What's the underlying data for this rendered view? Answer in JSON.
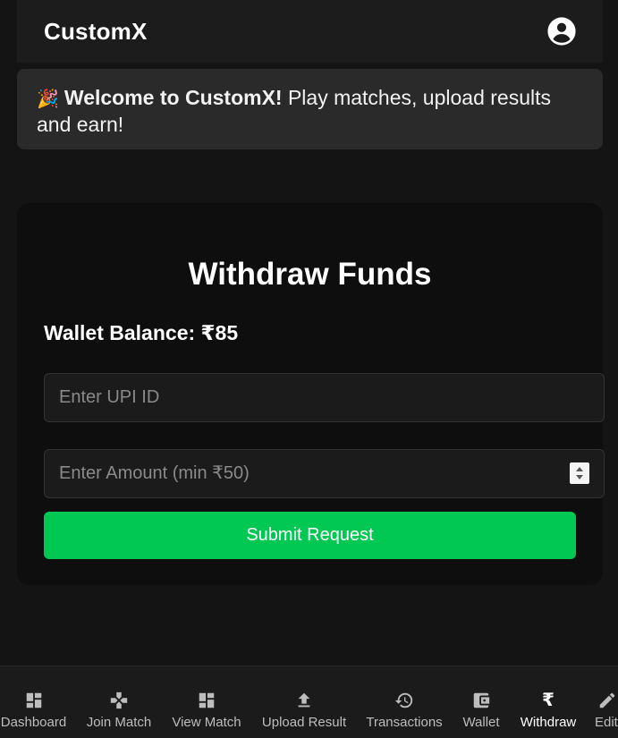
{
  "header": {
    "brand": "CustomX",
    "profile_icon": "account-circle-icon"
  },
  "banner": {
    "emoji": "🎉",
    "bold_text": "Welcome to CustomX!",
    "text": " Play matches, upload results and earn!"
  },
  "withdraw": {
    "title": "Withdraw Funds",
    "balance_label": "Wallet Balance: ₹85",
    "upi_placeholder": "Enter UPI ID",
    "upi_value": "",
    "amount_placeholder": "Enter Amount (min ₹50)",
    "amount_value": "",
    "submit_label": "Submit Request"
  },
  "nav": {
    "items": [
      {
        "label": "Dashboard",
        "icon": "dashboard-icon"
      },
      {
        "label": "Join Match",
        "icon": "gamepad-icon"
      },
      {
        "label": "View Match",
        "icon": "dashboard-icon"
      },
      {
        "label": "Upload Result",
        "icon": "upload-icon"
      },
      {
        "label": "Transactions",
        "icon": "history-icon"
      },
      {
        "label": "Wallet",
        "icon": "wallet-icon"
      },
      {
        "label": "Withdraw",
        "icon": "rupee-icon",
        "active": true
      },
      {
        "label": "Edit",
        "icon": "edit-icon"
      }
    ]
  },
  "colors": {
    "accent": "#00c853",
    "background": "#141414",
    "card": "#0e0e0e",
    "banner": "#2a2a2a"
  }
}
